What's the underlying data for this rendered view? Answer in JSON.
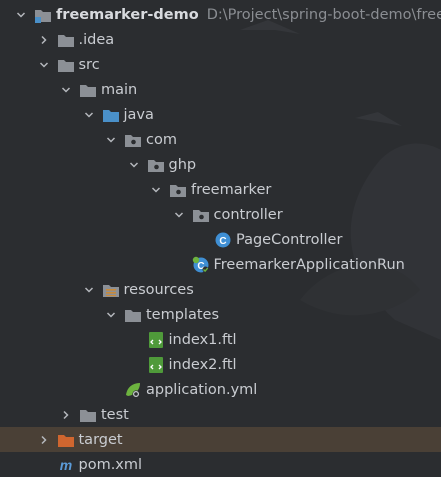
{
  "project": {
    "name": "freemarker-demo",
    "path": "D:\\Project\\spring-boot-demo\\free"
  },
  "tree": [
    {
      "name": "project-root",
      "level": 0,
      "arrow": "down",
      "icon": "module-folder-icon",
      "label": "freemarker-demo",
      "bold": true,
      "has_path": true
    },
    {
      "name": "folder-idea",
      "level": 1,
      "arrow": "right",
      "icon": "folder-icon",
      "label": ".idea"
    },
    {
      "name": "folder-src",
      "level": 1,
      "arrow": "down",
      "icon": "folder-icon",
      "label": "src"
    },
    {
      "name": "folder-main",
      "level": 2,
      "arrow": "down",
      "icon": "folder-icon",
      "label": "main"
    },
    {
      "name": "folder-java",
      "level": 3,
      "arrow": "down",
      "icon": "source-folder-icon",
      "label": "java"
    },
    {
      "name": "package-com",
      "level": 4,
      "arrow": "down",
      "icon": "package-icon",
      "label": "com"
    },
    {
      "name": "package-ghp",
      "level": 5,
      "arrow": "down",
      "icon": "package-icon",
      "label": "ghp"
    },
    {
      "name": "package-freemarker",
      "level": 6,
      "arrow": "down",
      "icon": "package-icon",
      "label": "freemarker"
    },
    {
      "name": "package-controller",
      "level": 7,
      "arrow": "down",
      "icon": "package-icon",
      "label": "controller"
    },
    {
      "name": "file-pagecontroller",
      "level": 8,
      "arrow": "none",
      "icon": "class-icon",
      "label": "PageController"
    },
    {
      "name": "file-freemarkerapplicationrun",
      "level": 7,
      "arrow": "none",
      "icon": "spring-boot-class-icon",
      "label": "FreemarkerApplicationRun"
    },
    {
      "name": "folder-resources",
      "level": 3,
      "arrow": "down",
      "icon": "resources-folder-icon",
      "label": "resources"
    },
    {
      "name": "folder-templates",
      "level": 4,
      "arrow": "down",
      "icon": "folder-icon",
      "label": "templates"
    },
    {
      "name": "file-index1",
      "level": 5,
      "arrow": "none",
      "icon": "ftl-file-icon",
      "label": "index1.ftl"
    },
    {
      "name": "file-index2",
      "level": 5,
      "arrow": "none",
      "icon": "ftl-file-icon",
      "label": "index2.ftl"
    },
    {
      "name": "file-application-yml",
      "level": 4,
      "arrow": "none",
      "icon": "spring-config-icon",
      "label": "application.yml"
    },
    {
      "name": "folder-test",
      "level": 2,
      "arrow": "right",
      "icon": "folder-icon",
      "label": "test"
    },
    {
      "name": "folder-target",
      "level": 1,
      "arrow": "right",
      "icon": "excluded-folder-icon",
      "label": "target",
      "selected": true
    },
    {
      "name": "file-pom-xml",
      "level": 1,
      "arrow": "none",
      "icon": "maven-icon",
      "label": "pom.xml"
    }
  ],
  "colors": {
    "background": "#2b2d30",
    "text": "#c9ccd1",
    "path_text": "#8a8d92",
    "folder": "#8c9096",
    "source_folder": "#4a90c9",
    "excluded_folder": "#d0662f",
    "class_circle": "#3f8fd4",
    "ftl_green": "#4f9a3a",
    "spring_green": "#6db33f",
    "maven_blue": "#5b9bd8",
    "selection": "#4a4036"
  }
}
